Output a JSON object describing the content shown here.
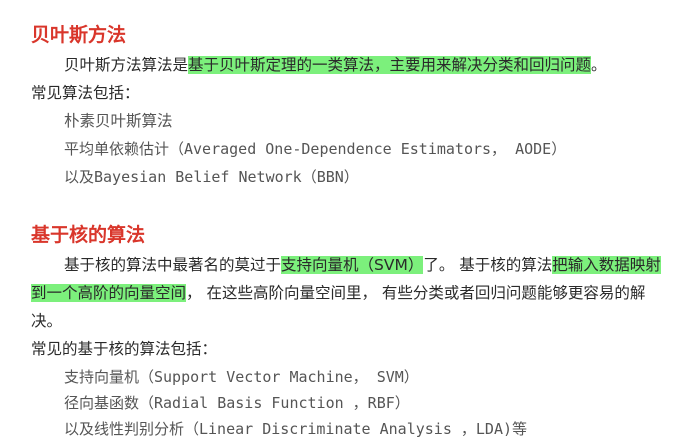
{
  "section1": {
    "title": "贝叶斯方法",
    "intro_pre": "贝叶斯方法算法是",
    "intro_highlight": "基于贝叶斯定理的一类算法，主要用来解决分类和回归问题",
    "intro_post": "。",
    "list_heading": "常见算法包括：",
    "items": [
      "朴素贝叶斯算法",
      "平均单依赖估计（Averaged One-Dependence Estimators， AODE）",
      "以及Bayesian Belief Network（BBN）"
    ]
  },
  "section2": {
    "title": "基于核的算法",
    "p1_pre": "基于核的算法中最著名的莫过于",
    "p1_highlight": "支持向量机（SVM）",
    "p1_mid": "了。 基于核的算法",
    "p1_highlight2": "把输入数据映射",
    "p2_highlight": "到一个高阶的向量空间",
    "p2_rest": "， 在这些高阶向量空间里， 有些分类或者回归问题能够更容易的解",
    "p3": "决。",
    "list_heading": "常见的基于核的算法包括：",
    "items": [
      "支持向量机（Support Vector Machine， SVM）",
      "径向基函数（Radial Basis Function ，RBF）",
      "以及线性判别分析（Linear Discriminate Analysis ，LDA)等"
    ]
  },
  "colors": {
    "title": "#d9362b",
    "highlight": "#7cf07c",
    "text": "#2a2a2a",
    "list_text": "#555555"
  }
}
